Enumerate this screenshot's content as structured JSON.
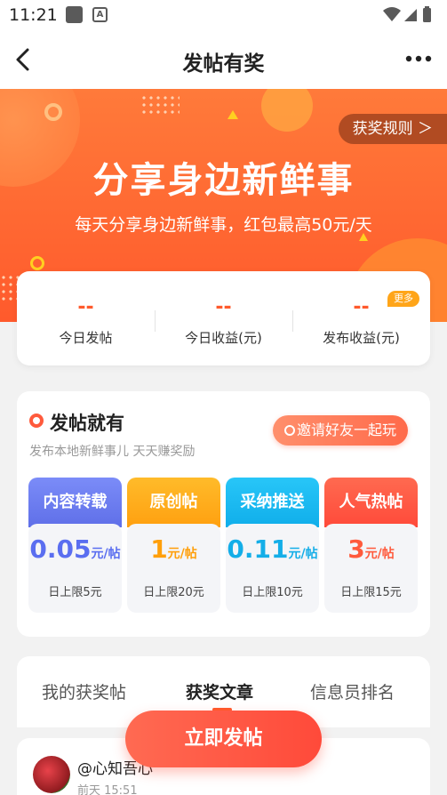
{
  "status_bar": {
    "time": "11:21"
  },
  "nav": {
    "title": "发帖有奖"
  },
  "banner": {
    "title": "分享身边新鲜事",
    "subtitle": "每天分享身边新鲜事，红包最高50元/天",
    "rules_label": "获奖规则 ＞"
  },
  "stats": {
    "items": [
      {
        "value": "--",
        "label": "今日发帖"
      },
      {
        "value": "--",
        "label": "今日收益(元)"
      },
      {
        "value": "--",
        "label": "发布收益(元)"
      }
    ],
    "more_badge": "更多"
  },
  "post_section": {
    "title": "发帖就有",
    "subtitle": "发布本地新鲜事儿 天天赚奖励",
    "invite_label": "邀请好友一起玩",
    "tiles": [
      {
        "name": "内容转载",
        "price": "0.05",
        "unit": "元/帖",
        "limit": "日上限5元",
        "color": "#6b7cf0",
        "price_color": "#5a6ef0"
      },
      {
        "name": "原创帖",
        "price": "1",
        "unit": "元/帖",
        "limit": "日上限20元",
        "color": "#ffab1a",
        "price_color": "#ff9f0a"
      },
      {
        "name": "采纳推送",
        "price": "0.11",
        "unit": "元/帖",
        "limit": "日上限10元",
        "color": "#1ab8f0",
        "price_color": "#14aee8"
      },
      {
        "name": "人气热帖",
        "price": "3",
        "unit": "元/帖",
        "limit": "日上限15元",
        "color": "#ff5a3c",
        "price_color": "#ff5a3c"
      }
    ]
  },
  "tabs": [
    {
      "label": "我的获奖帖"
    },
    {
      "label": "获奖文章"
    },
    {
      "label": "信息员排名"
    }
  ],
  "list": {
    "items": [
      {
        "user": "@心知吾心",
        "time": "前天 15:51"
      }
    ]
  },
  "fab": {
    "label": "立即发帖"
  }
}
